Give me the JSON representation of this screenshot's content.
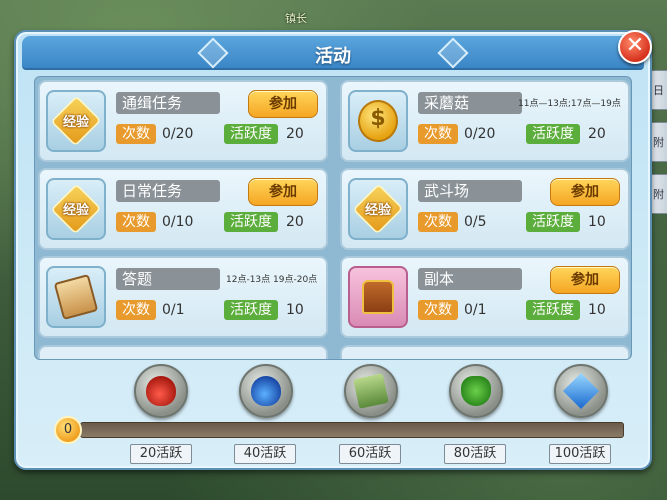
{
  "scene": {
    "label": "镇长"
  },
  "right_tabs": [
    "日",
    "附",
    "附"
  ],
  "panel": {
    "title": "活动",
    "close_label": "✕"
  },
  "labels": {
    "count": "次数",
    "activity": "活跃度",
    "join": "参加"
  },
  "activities": [
    {
      "name": "通缉任务",
      "icon": "exp-icon",
      "icon_text": "经验",
      "count": "0/20",
      "activity": "20",
      "has_button": true,
      "time": ""
    },
    {
      "name": "采蘑菇",
      "icon": "coin-icon",
      "icon_text": "$",
      "count": "0/20",
      "activity": "20",
      "has_button": false,
      "time": "11点—13点;17点—19点"
    },
    {
      "name": "日常任务",
      "icon": "exp-icon",
      "icon_text": "经验",
      "count": "0/10",
      "activity": "20",
      "has_button": true,
      "time": ""
    },
    {
      "name": "武斗场",
      "icon": "exp-icon",
      "icon_text": "经验",
      "count": "0/5",
      "activity": "10",
      "has_button": true,
      "time": ""
    },
    {
      "name": "答题",
      "icon": "scroll-icon",
      "icon_text": "",
      "count": "0/1",
      "activity": "10",
      "has_button": false,
      "time": "12点-13点 19点-20点"
    },
    {
      "name": "副本",
      "icon": "chest-icon",
      "icon_text": "",
      "count": "0/1",
      "activity": "10",
      "has_button": true,
      "time": ""
    }
  ],
  "rewards": [
    {
      "icon": "red-potion-icon"
    },
    {
      "icon": "blue-potion-icon"
    },
    {
      "icon": "scroll-reward-icon"
    },
    {
      "icon": "clover-icon"
    },
    {
      "icon": "gem-icon"
    }
  ],
  "progress": {
    "current": "0",
    "fraction": 0
  },
  "milestones": [
    "20活跃",
    "40活跃",
    "60活跃",
    "80活跃",
    "100活跃"
  ],
  "colors": {
    "title_bar": "#3b86c6",
    "join_button": "#f5a623",
    "count_tag": "#e89a2c",
    "activity_tag": "#5cae3c"
  }
}
